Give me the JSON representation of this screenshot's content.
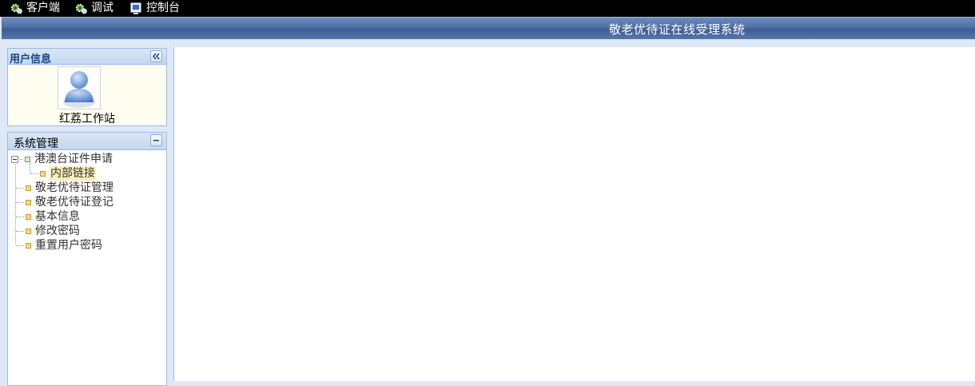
{
  "toolbar": {
    "items": [
      {
        "label": "客户端",
        "icon": "gear-icon"
      },
      {
        "label": "调试",
        "icon": "gear-icon"
      },
      {
        "label": "控制台",
        "icon": "console-icon"
      }
    ]
  },
  "banner": {
    "title": "敬老优待证在线受理系统"
  },
  "user_panel": {
    "title": "用户信息",
    "user_name": "红荔工作站",
    "collapse_icon": "double-chevron-left-icon"
  },
  "system_panel": {
    "title": "系统管理",
    "collapse_icon": "minus-icon",
    "tree": {
      "folder": "港澳台证件申请",
      "folder_children": [
        "内部链接"
      ],
      "items": [
        "敬老优待证管理",
        "敬老优待证登记",
        "基本信息",
        "修改密码",
        "重置用户密码"
      ]
    }
  },
  "colors": {
    "banner": "#4f6fa3",
    "panel_border": "#99bbe8",
    "selected_bg": "#ffefb8"
  }
}
